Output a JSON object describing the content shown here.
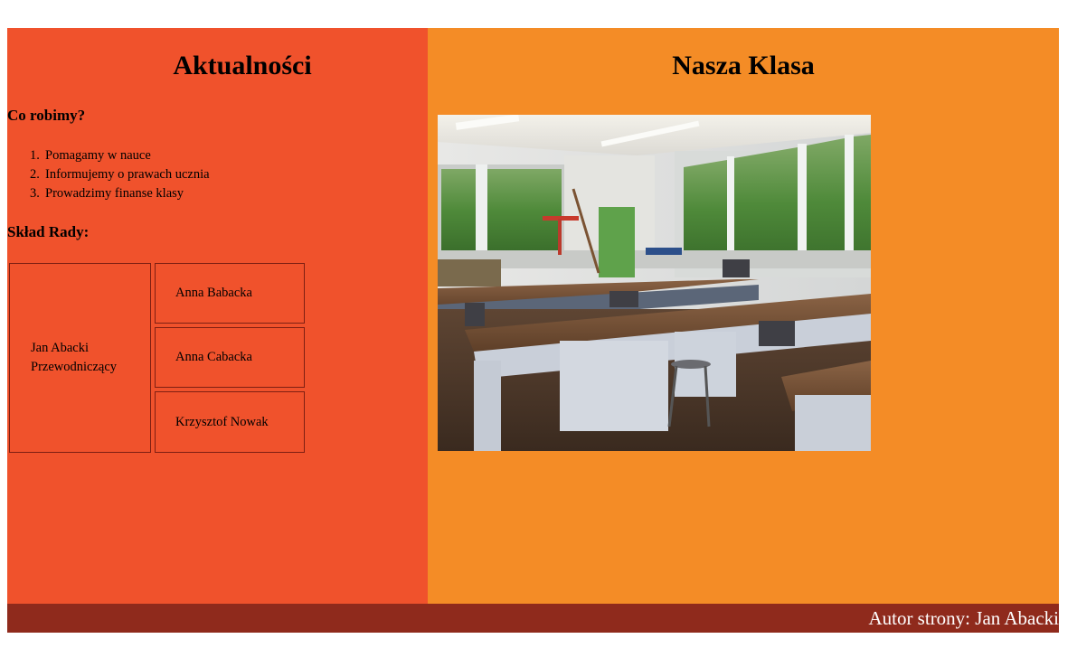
{
  "left": {
    "title": "Aktualności",
    "activities_heading": "Co robimy?",
    "activities": [
      {
        "num": "1.",
        "text": "Pomagamy w nauce"
      },
      {
        "num": "2.",
        "text": "Informujemy o prawach ucznia"
      },
      {
        "num": "3.",
        "text": "Prowadzimy finanse klasy"
      }
    ],
    "council_heading": "Skład Rady:",
    "council": {
      "chair_name": "Jan Abacki",
      "chair_role": "Przewodniczący",
      "members": [
        "Anna Babacka",
        "Anna Cabacka",
        "Krzysztof Nowak"
      ]
    }
  },
  "right": {
    "title": "Nasza Klasa"
  },
  "footer": {
    "author_text": "Autor strony: Jan Abacki"
  },
  "colors": {
    "left_bg": "#f0522c",
    "right_bg": "#f48c26",
    "footer_bg": "#8f2a1c",
    "box_border": "#7e1f12"
  }
}
